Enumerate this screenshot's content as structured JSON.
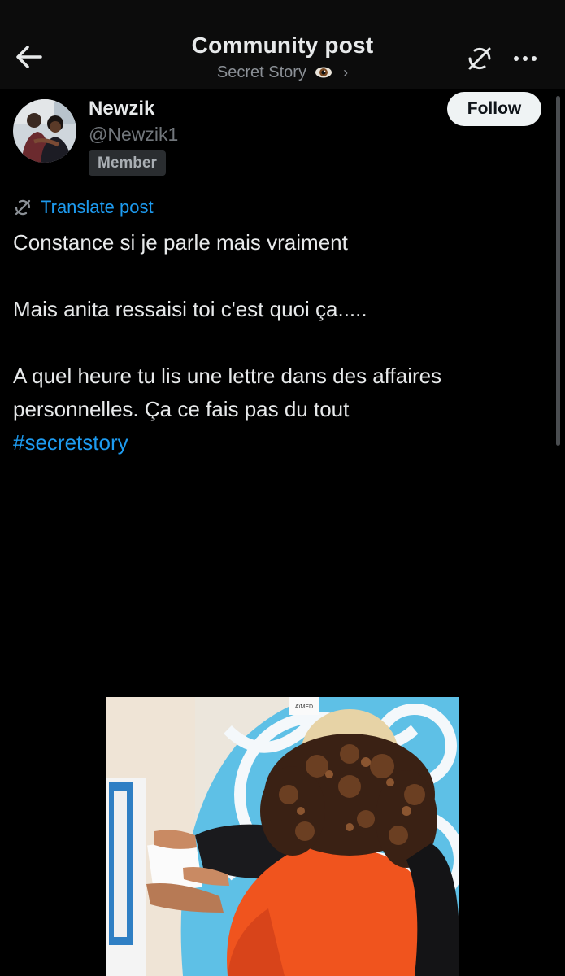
{
  "header": {
    "title": "Community post",
    "community": "Secret Story",
    "community_chevron": "›",
    "icons": {
      "back": "arrow-left-icon",
      "community_emoji": "eye-icon",
      "translate": "translate-off-icon",
      "more": "more-icon"
    }
  },
  "author": {
    "name": "Newzik",
    "handle": "@Newzik1",
    "badge": "Member",
    "follow_label": "Follow"
  },
  "post": {
    "translate_label": "Translate post",
    "line1": "Constance si je parle mais vraiment",
    "line2": "Mais anita ressaisi toi c'est quoi ça.....",
    "line3a": "A quel heure tu lis une lettre dans des affaires",
    "line3b": "personnelles.  Ça ce fais pas du tout",
    "hashtag": "#secretstory"
  },
  "media": {
    "door_sign": "AïMED"
  },
  "colors": {
    "background": "#000000",
    "text": "#e7e9ea",
    "secondary": "#71767b",
    "link": "#1d9bf0",
    "follow_bg": "#eff3f4"
  }
}
